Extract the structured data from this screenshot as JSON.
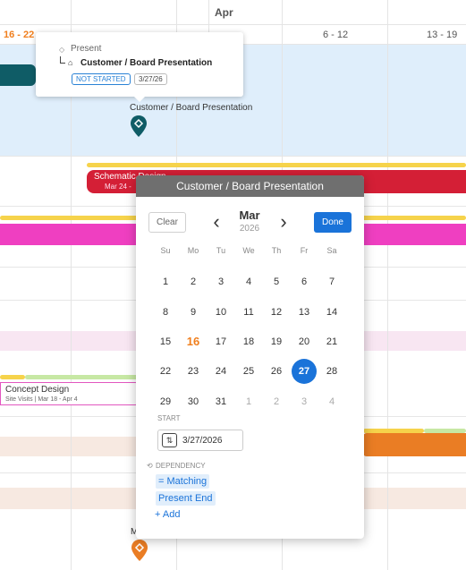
{
  "timeline": {
    "month": "Apr",
    "weeks": [
      "16 - 22",
      "6 - 12",
      "13 - 19"
    ],
    "accent": "#f07f1e"
  },
  "tooltip": {
    "parent": "Present",
    "title": "Customer / Board Presentation",
    "status": "NOT STARTED",
    "date": "3/27/26"
  },
  "milestone": {
    "label": "Customer / Board Presentation",
    "color": "#0f5c66"
  },
  "bars": {
    "schematic": "Schematic Design",
    "schematic_dates": "Mar 24 -",
    "concept_title": "Concept Design",
    "concept_sub": "Site Visits  |  Mar 18 - Apr 4"
  },
  "bottom_milestone_label": "M",
  "popup": {
    "title": "Customer / Board Presentation",
    "clear_label": "Clear",
    "done_label": "Done",
    "month": "Mar",
    "year": "2026",
    "weekdays": [
      "Su",
      "Mo",
      "Tu",
      "We",
      "Th",
      "Fr",
      "Sa"
    ],
    "weeks": [
      [
        "1",
        "2",
        "3",
        "4",
        "5",
        "6",
        "7"
      ],
      [
        "8",
        "9",
        "10",
        "11",
        "12",
        "13",
        "14"
      ],
      [
        "15",
        "16",
        "17",
        "18",
        "19",
        "20",
        "21"
      ],
      [
        "22",
        "23",
        "24",
        "25",
        "26",
        "27",
        "28"
      ],
      [
        "29",
        "30",
        "31",
        "1",
        "2",
        "3",
        "4"
      ]
    ],
    "today": "16",
    "selected": "27",
    "start_label": "START",
    "start_value": "3/27/2026",
    "dependency_label": "DEPENDENCY",
    "dependencies": [
      "Matching",
      "Present End"
    ],
    "add_label": "+ Add",
    "accent": "#1a73d9"
  }
}
